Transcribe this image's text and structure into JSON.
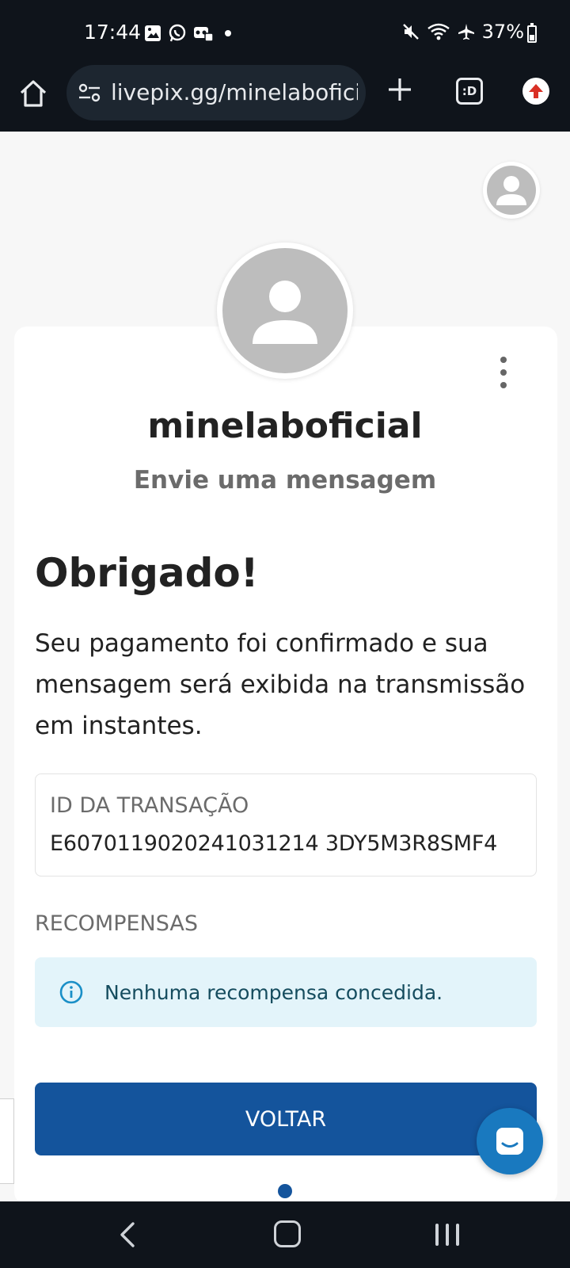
{
  "status_bar": {
    "time": "17:44",
    "battery": "37%",
    "icons_left": [
      "gallery-icon",
      "whatsapp-icon",
      "voicemail-icon",
      "notification-dot"
    ],
    "icons_right": [
      "mute-icon",
      "wifi-icon",
      "airplane-icon",
      "battery-icon"
    ]
  },
  "browser": {
    "url": "livepix.gg/minelaboficial",
    "tab_switcher_label": ":D"
  },
  "profile": {
    "username": "minelaboficial",
    "subtitle": "Envie uma mensagem"
  },
  "confirmation": {
    "title": "Obrigado!",
    "message": "Seu pagamento foi confirmado e sua mensagem será exibida na transmissão em instantes."
  },
  "transaction": {
    "label": "ID DA TRANSAÇÃO",
    "id": "E6070119020241031214 3DY5M3R8SMF4"
  },
  "rewards": {
    "title": "RECOMPENSAS",
    "empty_text": "Nenhuma recompensa concedida."
  },
  "actions": {
    "back_label": "VOLTAR"
  },
  "colors": {
    "primary": "#14549c",
    "chat": "#1979bf",
    "alert_bg": "#e3f4fa",
    "alert_text": "#154c5e",
    "system_bar": "#0f141b"
  }
}
